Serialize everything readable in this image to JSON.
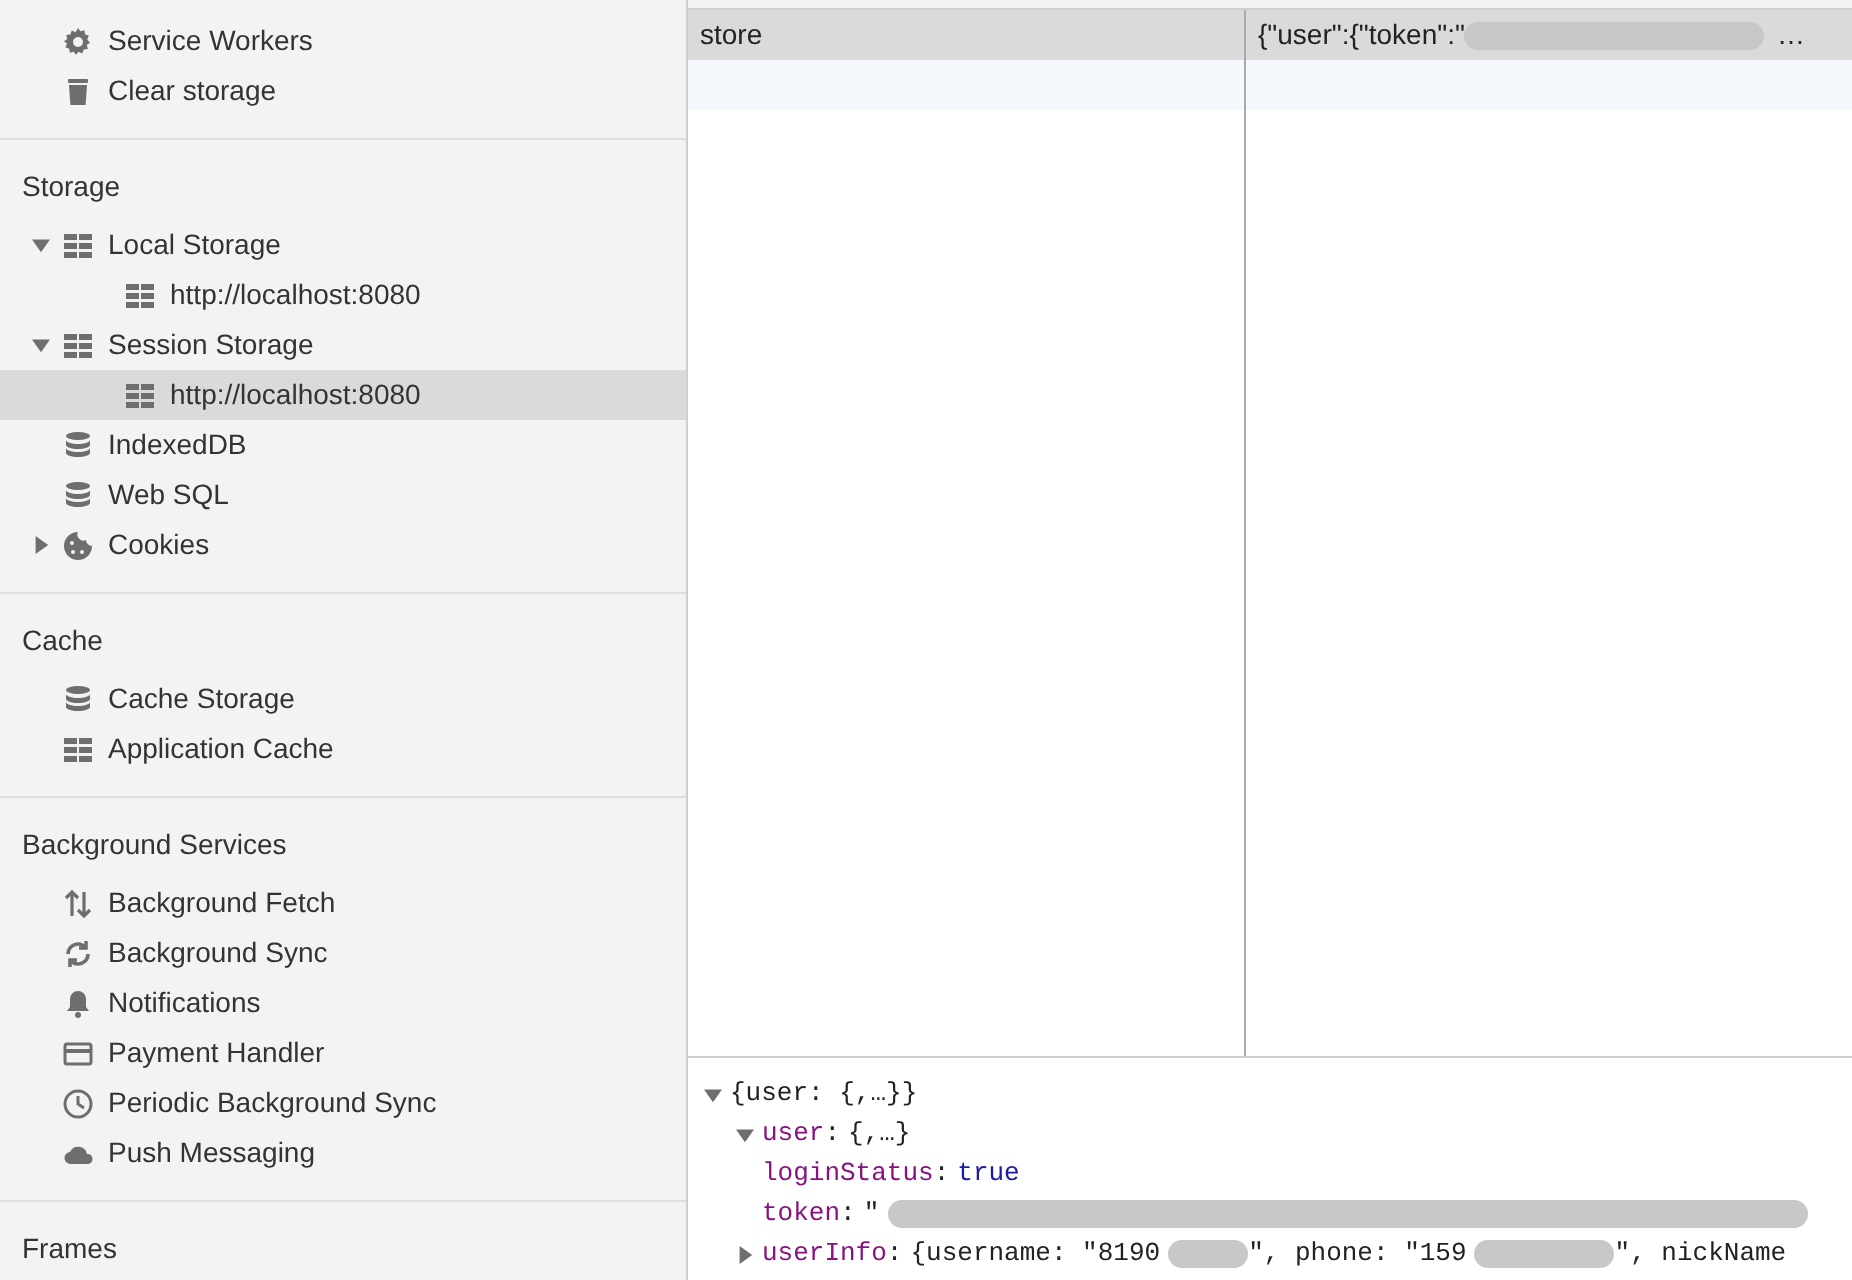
{
  "sidebar": {
    "sections": [
      {
        "items": [
          {
            "label": "Service Workers",
            "kind": "gear",
            "selected": false
          },
          {
            "label": "Clear storage",
            "kind": "trash",
            "selected": false
          }
        ]
      },
      {
        "title": "Storage",
        "items": [
          {
            "label": "Local Storage",
            "kind": "grid",
            "selected": false,
            "expanded": true,
            "children": [
              {
                "label": "http://localhost:8080",
                "kind": "grid",
                "selected": false
              }
            ]
          },
          {
            "label": "Session Storage",
            "kind": "grid",
            "selected": false,
            "expanded": true,
            "children": [
              {
                "label": "http://localhost:8080",
                "kind": "grid",
                "selected": true
              }
            ]
          },
          {
            "label": "IndexedDB",
            "kind": "database",
            "selected": false
          },
          {
            "label": "Web SQL",
            "kind": "database",
            "selected": false
          },
          {
            "label": "Cookies",
            "kind": "cookie",
            "selected": false,
            "expanded": false
          }
        ]
      },
      {
        "title": "Cache",
        "items": [
          {
            "label": "Cache Storage",
            "kind": "database",
            "selected": false
          },
          {
            "label": "Application Cache",
            "kind": "grid",
            "selected": false
          }
        ]
      },
      {
        "title": "Background Services",
        "items": [
          {
            "label": "Background Fetch",
            "kind": "updown",
            "selected": false
          },
          {
            "label": "Background Sync",
            "kind": "sync",
            "selected": false
          },
          {
            "label": "Notifications",
            "kind": "bell",
            "selected": false
          },
          {
            "label": "Payment Handler",
            "kind": "card",
            "selected": false
          },
          {
            "label": "Periodic Background Sync",
            "kind": "clock",
            "selected": false
          },
          {
            "label": "Push Messaging",
            "kind": "cloud",
            "selected": false
          }
        ]
      },
      {
        "title": "Frames"
      }
    ]
  },
  "table": {
    "rows": [
      {
        "key": "store",
        "value": "{\"user\":{\"token\":\"",
        "value_end": "…",
        "selected": true
      }
    ]
  },
  "preview": {
    "summary": "{user: {,…}}",
    "expanded": true,
    "children": [
      {
        "key": "user",
        "separator": ":",
        "summary": "{,…}",
        "expanded": true,
        "children": [
          {
            "key": "loginStatus",
            "separator": ":",
            "kind": "bool",
            "value": "true"
          },
          {
            "key": "token",
            "separator": ":",
            "kind": "redacted",
            "parts": [
              "\""
            ]
          },
          {
            "key": "userInfo",
            "separator": ":",
            "kind": "object",
            "expanded": false,
            "parts": [
              "{username: \"8190",
              "\", phone: \"159",
              "\", nickName"
            ]
          }
        ]
      }
    ]
  }
}
